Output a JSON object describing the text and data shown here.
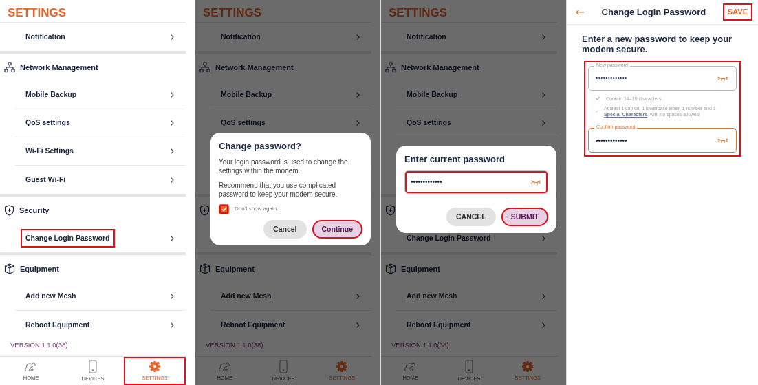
{
  "screens": [
    {
      "kind": "list",
      "title": "SETTINGS",
      "sections": [
        {
          "kind": "plain",
          "items": [
            {
              "kind": "row",
              "label": "Notification",
              "highlighted": false
            }
          ]
        },
        {
          "kind": "network",
          "label": "Network Management",
          "items": [
            {
              "kind": "row",
              "label": "Mobile Backup",
              "highlighted": false
            },
            {
              "kind": "row",
              "label": "QoS settings",
              "highlighted": false
            },
            {
              "kind": "row",
              "label": "Wi-Fi Settings",
              "highlighted": false
            },
            {
              "kind": "row",
              "label": "Guest Wi-Fi",
              "highlighted": false
            }
          ]
        },
        {
          "kind": "security",
          "label": "Security",
          "items": [
            {
              "kind": "row",
              "label": "Change Login Password",
              "highlighted": true
            }
          ]
        },
        {
          "kind": "equipment",
          "label": "Equipment",
          "items": [
            {
              "kind": "row",
              "label": "Add new Mesh",
              "highlighted": false
            },
            {
              "kind": "row",
              "label": "Reboot Equipment",
              "highlighted": false
            }
          ]
        }
      ],
      "version": "VERSION 1.1.0(38)",
      "nav": [
        {
          "kind": "home",
          "label": "HOME",
          "selected": false,
          "highlighted": false
        },
        {
          "kind": "devices",
          "label": "DEVICES",
          "selected": false,
          "highlighted": false
        },
        {
          "kind": "settings",
          "label": "SETTINGS",
          "selected": true,
          "highlighted": true
        }
      ]
    },
    {
      "kind": "list",
      "title": "SETTINGS",
      "sections": [
        {
          "kind": "plain",
          "items": [
            {
              "kind": "row",
              "label": "Notification",
              "highlighted": false
            }
          ]
        },
        {
          "kind": "network",
          "label": "Network Management",
          "items": [
            {
              "kind": "row",
              "label": "Mobile Backup",
              "highlighted": false
            },
            {
              "kind": "row",
              "label": "QoS settings",
              "highlighted": false
            },
            {
              "kind": "hidden"
            },
            {
              "kind": "hidden"
            }
          ]
        },
        {
          "kind": "security",
          "items": [
            {
              "kind": "hidden"
            }
          ]
        },
        {
          "kind": "equipment",
          "label": "Equipment",
          "items": [
            {
              "kind": "row",
              "label": "Add new Mesh",
              "highlighted": false
            },
            {
              "kind": "row",
              "label": "Reboot Equipment",
              "highlighted": false
            }
          ]
        }
      ],
      "version": "VERSION 1.1.0(38)",
      "nav": [
        {
          "kind": "home",
          "label": "HOME",
          "selected": false,
          "highlighted": false
        },
        {
          "kind": "devices",
          "label": "DEVICES",
          "selected": false,
          "highlighted": false
        },
        {
          "kind": "settings",
          "label": "SETTINGS",
          "selected": true,
          "highlighted": false
        }
      ],
      "dialog": {
        "kind": "confirm",
        "title": "Change password?",
        "paragraphs": [
          "Your login password is used to change the settings within the modem.",
          "Recommend that you use complicated password to keep your modem secure."
        ],
        "checkbox": {
          "label": "Don't show again.",
          "checked": true,
          "highlighted": true
        },
        "buttons": [
          {
            "kind": "secondary",
            "label": "Cancel",
            "highlighted": false
          },
          {
            "kind": "primary",
            "label": "Continue",
            "highlighted": true
          }
        ]
      }
    },
    {
      "kind": "list",
      "title": "SETTINGS",
      "sections": [
        {
          "kind": "plain",
          "items": [
            {
              "kind": "row",
              "label": "Notification",
              "highlighted": false
            }
          ]
        },
        {
          "kind": "network",
          "label": "Network Management",
          "items": [
            {
              "kind": "row",
              "label": "Mobile Backup",
              "highlighted": false
            },
            {
              "kind": "row",
              "label": "QoS settings",
              "highlighted": false
            },
            {
              "kind": "hidden"
            },
            {
              "kind": "hidden"
            }
          ]
        },
        {
          "kind": "security",
          "items": [
            {
              "kind": "row",
              "label": "Change Login Password",
              "highlighted": false
            }
          ]
        },
        {
          "kind": "equipment",
          "label": "Equipment",
          "items": [
            {
              "kind": "row",
              "label": "Add new Mesh",
              "highlighted": false
            },
            {
              "kind": "row",
              "label": "Reboot Equipment",
              "highlighted": false
            }
          ]
        }
      ],
      "version": "VERSION 1.1.0(38)",
      "nav": [
        {
          "kind": "home",
          "label": "HOME",
          "selected": false,
          "highlighted": false
        },
        {
          "kind": "devices",
          "label": "DEVICES",
          "selected": false,
          "highlighted": false
        },
        {
          "kind": "settings",
          "label": "SETTINGS",
          "selected": true,
          "highlighted": false
        }
      ],
      "dialog": {
        "kind": "prompt",
        "title": "Enter current password",
        "field": {
          "value": "•••••••••••••",
          "highlighted": true
        },
        "buttons": [
          {
            "kind": "secondary",
            "label": "CANCEL",
            "highlighted": false
          },
          {
            "kind": "primary",
            "label": "SUBMIT",
            "highlighted": true
          }
        ]
      }
    },
    {
      "kind": "form",
      "title": "Change Login Password",
      "action": {
        "label": "SAVE",
        "highlighted": true
      },
      "heading": "Enter a new password to keep your modem secure.",
      "group_highlighted": true,
      "fields": [
        {
          "label": "New password",
          "value": "•••••••••••••",
          "focused": false
        },
        {
          "label": "Confirm password",
          "value": "•••••••••••••",
          "focused": true
        }
      ],
      "rules": [
        {
          "text": "Contain 14–16 characters"
        },
        {
          "text": "At least 1 capital, 1 lowercase letter, 1 number and 1",
          "link": "Special Characters",
          "text_after": ", with no spaces allowed"
        }
      ]
    }
  ]
}
